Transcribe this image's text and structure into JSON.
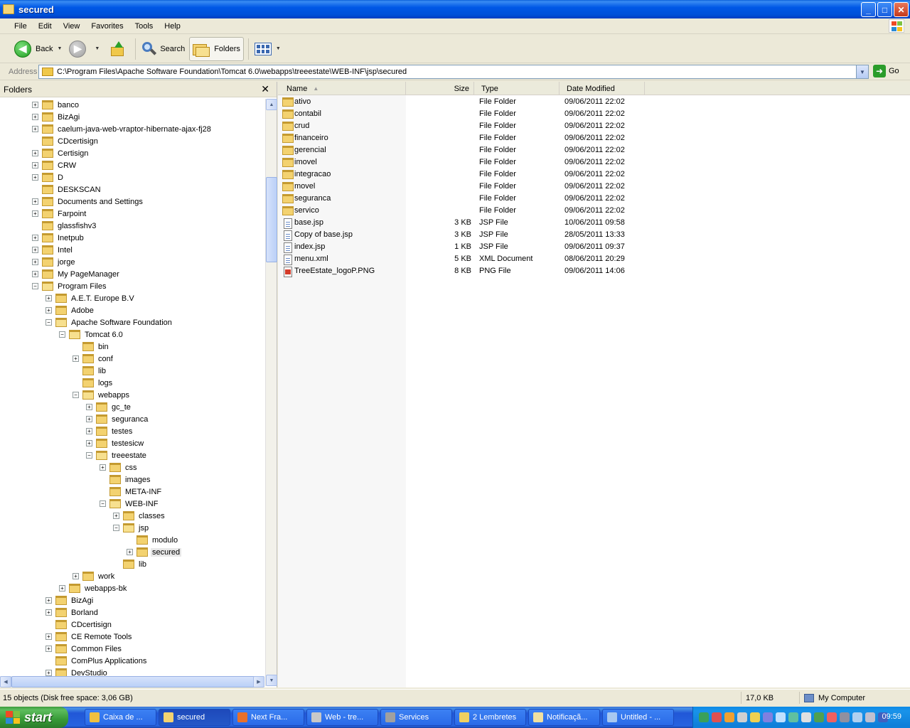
{
  "window": {
    "title": "secured"
  },
  "menu": [
    "File",
    "Edit",
    "View",
    "Favorites",
    "Tools",
    "Help"
  ],
  "toolbar": {
    "back_label": "Back",
    "search_label": "Search",
    "folders_label": "Folders"
  },
  "address": {
    "label": "Address",
    "value": "C:\\Program Files\\Apache Software Foundation\\Tomcat 6.0\\webapps\\treeestate\\WEB-INF\\jsp\\secured",
    "go_label": "Go"
  },
  "folder_pane": {
    "title": "Folders",
    "tree": [
      {
        "label": "banco",
        "level": 0,
        "exp": "+"
      },
      {
        "label": "BizAgi",
        "level": 0,
        "exp": "+"
      },
      {
        "label": "caelum-java-web-vraptor-hibernate-ajax-fj28",
        "level": 0,
        "exp": "+"
      },
      {
        "label": "CDcertisign",
        "level": 0,
        "exp": ""
      },
      {
        "label": "Certisign",
        "level": 0,
        "exp": "+"
      },
      {
        "label": "CRW",
        "level": 0,
        "exp": "+"
      },
      {
        "label": "D",
        "level": 0,
        "exp": "+"
      },
      {
        "label": "DESKSCAN",
        "level": 0,
        "exp": ""
      },
      {
        "label": "Documents and Settings",
        "level": 0,
        "exp": "+"
      },
      {
        "label": "Farpoint",
        "level": 0,
        "exp": "+"
      },
      {
        "label": "glassfishv3",
        "level": 0,
        "exp": ""
      },
      {
        "label": "Inetpub",
        "level": 0,
        "exp": "+"
      },
      {
        "label": "Intel",
        "level": 0,
        "exp": "+"
      },
      {
        "label": "jorge",
        "level": 0,
        "exp": "+"
      },
      {
        "label": "My PageManager",
        "level": 0,
        "exp": "+"
      },
      {
        "label": "Program Files",
        "level": 0,
        "exp": "-"
      },
      {
        "label": "A.E.T. Europe B.V",
        "level": 1,
        "exp": "+"
      },
      {
        "label": "Adobe",
        "level": 1,
        "exp": "+"
      },
      {
        "label": "Apache Software Foundation",
        "level": 1,
        "exp": "-"
      },
      {
        "label": "Tomcat 6.0",
        "level": 2,
        "exp": "-"
      },
      {
        "label": "bin",
        "level": 3,
        "exp": ""
      },
      {
        "label": "conf",
        "level": 3,
        "exp": "+"
      },
      {
        "label": "lib",
        "level": 3,
        "exp": ""
      },
      {
        "label": "logs",
        "level": 3,
        "exp": ""
      },
      {
        "label": "webapps",
        "level": 3,
        "exp": "-"
      },
      {
        "label": "gc_te",
        "level": 4,
        "exp": "+"
      },
      {
        "label": "seguranca",
        "level": 4,
        "exp": "+"
      },
      {
        "label": "testes",
        "level": 4,
        "exp": "+"
      },
      {
        "label": "testesicw",
        "level": 4,
        "exp": "+"
      },
      {
        "label": "treeestate",
        "level": 4,
        "exp": "-"
      },
      {
        "label": "css",
        "level": 5,
        "exp": "+"
      },
      {
        "label": "images",
        "level": 5,
        "exp": ""
      },
      {
        "label": "META-INF",
        "level": 5,
        "exp": ""
      },
      {
        "label": "WEB-INF",
        "level": 5,
        "exp": "-"
      },
      {
        "label": "classes",
        "level": 6,
        "exp": "+"
      },
      {
        "label": "jsp",
        "level": 6,
        "exp": "-"
      },
      {
        "label": "modulo",
        "level": 7,
        "exp": ""
      },
      {
        "label": "secured",
        "level": 7,
        "exp": "+",
        "selected": true
      },
      {
        "label": "lib",
        "level": 6,
        "exp": ""
      },
      {
        "label": "work",
        "level": 3,
        "exp": "+"
      },
      {
        "label": "webapps-bk",
        "level": 2,
        "exp": "+"
      },
      {
        "label": "BizAgi",
        "level": 1,
        "exp": "+"
      },
      {
        "label": "Borland",
        "level": 1,
        "exp": "+"
      },
      {
        "label": "CDcertisign",
        "level": 1,
        "exp": ""
      },
      {
        "label": "CE Remote Tools",
        "level": 1,
        "exp": "+"
      },
      {
        "label": "Common Files",
        "level": 1,
        "exp": "+"
      },
      {
        "label": "ComPlus Applications",
        "level": 1,
        "exp": ""
      },
      {
        "label": "DevStudio",
        "level": 1,
        "exp": "+"
      }
    ]
  },
  "file_list": {
    "columns": [
      "Name",
      "Size",
      "Type",
      "Date Modified"
    ],
    "rows": [
      {
        "name": "ativo",
        "size": "",
        "type": "File Folder",
        "date": "09/06/2011 22:02",
        "icon": "folder"
      },
      {
        "name": "contabil",
        "size": "",
        "type": "File Folder",
        "date": "09/06/2011 22:02",
        "icon": "folder"
      },
      {
        "name": "crud",
        "size": "",
        "type": "File Folder",
        "date": "09/06/2011 22:02",
        "icon": "folder"
      },
      {
        "name": "financeiro",
        "size": "",
        "type": "File Folder",
        "date": "09/06/2011 22:02",
        "icon": "folder"
      },
      {
        "name": "gerencial",
        "size": "",
        "type": "File Folder",
        "date": "09/06/2011 22:02",
        "icon": "folder"
      },
      {
        "name": "imovel",
        "size": "",
        "type": "File Folder",
        "date": "09/06/2011 22:02",
        "icon": "folder"
      },
      {
        "name": "integracao",
        "size": "",
        "type": "File Folder",
        "date": "09/06/2011 22:02",
        "icon": "folder"
      },
      {
        "name": "movel",
        "size": "",
        "type": "File Folder",
        "date": "09/06/2011 22:02",
        "icon": "folder"
      },
      {
        "name": "seguranca",
        "size": "",
        "type": "File Folder",
        "date": "09/06/2011 22:02",
        "icon": "folder"
      },
      {
        "name": "servico",
        "size": "",
        "type": "File Folder",
        "date": "09/06/2011 22:02",
        "icon": "folder"
      },
      {
        "name": "base.jsp",
        "size": "3 KB",
        "type": "JSP File",
        "date": "10/06/2011 09:58",
        "icon": "file"
      },
      {
        "name": "Copy of base.jsp",
        "size": "3 KB",
        "type": "JSP File",
        "date": "28/05/2011 13:33",
        "icon": "file"
      },
      {
        "name": "index.jsp",
        "size": "1 KB",
        "type": "JSP File",
        "date": "09/06/2011 09:37",
        "icon": "file"
      },
      {
        "name": "menu.xml",
        "size": "5 KB",
        "type": "XML Document",
        "date": "08/06/2011 20:29",
        "icon": "file"
      },
      {
        "name": "TreeEstate_logoP.PNG",
        "size": "8 KB",
        "type": "PNG File",
        "date": "09/06/2011 14:06",
        "icon": "png"
      }
    ]
  },
  "status": {
    "objects": "15 objects (Disk free space: 3,06 GB)",
    "size": "17,0 KB",
    "location": "My Computer"
  },
  "taskbar": {
    "start_label": "start",
    "tasks": [
      {
        "label": "Caixa de ...",
        "color": "#f0c040"
      },
      {
        "label": "secured",
        "color": "#f3d270",
        "active": true
      },
      {
        "label": "Next Fra...",
        "color": "#e8702a"
      },
      {
        "label": "Web - tre...",
        "color": "#c8c8c8"
      },
      {
        "label": "Services",
        "color": "#a0a0a0"
      },
      {
        "label": "2 Lembretes",
        "color": "#f0d060"
      },
      {
        "label": "Notificaçã...",
        "color": "#f0e0a0"
      },
      {
        "label": "Untitled - ...",
        "color": "#a8c8f0"
      }
    ],
    "clock": "09:59"
  }
}
